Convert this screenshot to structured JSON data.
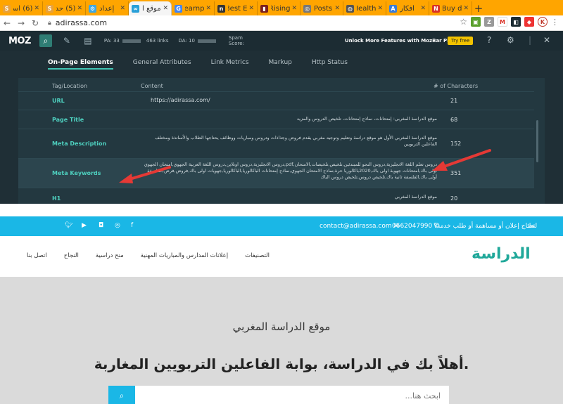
{
  "browser": {
    "tabs": [
      {
        "title": "(6) اسـ",
        "favicon_color": "#e8a13a",
        "favicon_letter": "S"
      },
      {
        "title": "(5) حد",
        "favicon_color": "#e8a13a",
        "favicon_letter": "S"
      },
      {
        "title": "إعداد",
        "favicon_color": "#3fa7e0",
        "favicon_letter": "⚙"
      },
      {
        "title": "موقع ا",
        "favicon_color": "#2aa0d8",
        "favicon_letter": "∞",
        "active": true
      },
      {
        "title": "learnp",
        "favicon_color": "#4285f4",
        "favicon_letter": "G"
      },
      {
        "title": "Best E",
        "favicon_color": "#333333",
        "favicon_letter": "n"
      },
      {
        "title": "Rising",
        "favicon_color": "#7a1f1f",
        "favicon_letter": "▮"
      },
      {
        "title": "Posts",
        "favicon_color": "#777777",
        "favicon_letter": "◎"
      },
      {
        "title": "Health",
        "favicon_color": "#555555",
        "favicon_letter": "◍"
      },
      {
        "title": "أفكار",
        "favicon_color": "#3b7dd8",
        "favicon_letter": "A"
      },
      {
        "title": "Buy d",
        "favicon_color": "#d93025",
        "favicon_letter": "N"
      }
    ],
    "url": "adirassa.com"
  },
  "mozbar": {
    "logo": "MOZ",
    "pa": "PA: 33",
    "links": "463 links",
    "da": "DA: 10",
    "spam": "Spam\nScore:",
    "unlock": "Unlock More Features with MozBar Premium",
    "try_free": "Try free",
    "tabs": [
      "On-Page Elements",
      "General Attributes",
      "Link Metrics",
      "Markup",
      "Http Status"
    ],
    "headers": {
      "tag": "Tag/Location",
      "content": "Content",
      "chars": "# of Characters"
    },
    "rows": [
      {
        "label": "URL",
        "value": "https://adirassa.com/",
        "chars": "21"
      },
      {
        "label": "Page Title",
        "value": "موقع الدراسة المغربي: إمتحانات، نماذج إمتحانات، تلخيص الدروس والمزيد",
        "chars": "68"
      },
      {
        "label": "Meta Description",
        "value": "موقع الدراسة المغربي الأول هو موقع دراسة وتعليم وتوجيه مغربي يقدم فروض وجذاذات ودروس ومباريات ووظائف يحتاجها الطلاب والأساتذة ومختلف الفاعلين التربويين",
        "chars": "152"
      },
      {
        "label": "Meta Keywords",
        "value": "دروس تعلم اللغة الانجليزية,دروس النحو للمبتدئين,تلخيص,تلخيصات,الامتحان,pdf,دروس الانجليزية,دروس اونلاين,دروس اللغة العربية الجهوي,امتحان الجهوي اولى باك,امتحانات جهوية اولى باك,2020باكالوريا حرة,نماذج الامتحان الجهوي,نماذج إمتحانات الباكالوريا,الباكالوريا,جهويات اولى باك,فروض,فرض,الفلسفة أولى باك,الفلسفة ثانية باك,تلخيص دروس,تلخيص دروس الباك",
        "chars": "351"
      },
      {
        "label": "H1",
        "value": "موقع الدراسة المغربي",
        "chars": "20"
      }
    ]
  },
  "site": {
    "promo": "تحتاج إعلان أو مساهمة أو طلب خدمة؟",
    "promo_short": "لحك",
    "phone": "0662047990",
    "email": "contact@adirassa.com",
    "menu": [
      "التصنيفات",
      "إعلانات المدارس والمباريات المهنية",
      "منح دراسية",
      "النجاح",
      "اتصل بنا"
    ],
    "logo": "الدراسة",
    "hero_subtitle": "موقع الدراسة المغربي",
    "hero_title": "أهلاً بك في الدراسة، بوابة الفاعلين التربويين المغاربة.",
    "search_placeholder": "ابحث هنا..."
  }
}
